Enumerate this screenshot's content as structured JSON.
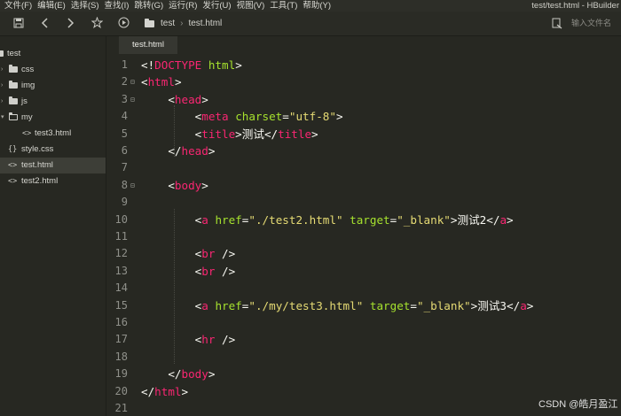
{
  "window": {
    "title": "test/test.html - HBuilder",
    "menu": [
      "文件(F)",
      "编辑(E)",
      "选择(S)",
      "查找(I)",
      "跳转(G)",
      "运行(R)",
      "发行(U)",
      "视图(V)",
      "工具(T)",
      "帮助(Y)"
    ]
  },
  "toolbar": {
    "icons": [
      "save-icon",
      "back-icon",
      "forward-icon",
      "star-icon",
      "run-icon"
    ],
    "breadcrumb": [
      "test",
      "test.html"
    ],
    "search_placeholder": "输入文件名"
  },
  "sidebar": {
    "items": [
      {
        "label": "test",
        "kind": "project",
        "icon": "project-folder-icon"
      },
      {
        "label": "css",
        "kind": "folder",
        "icon": "folder-icon"
      },
      {
        "label": "img",
        "kind": "folder",
        "icon": "folder-icon"
      },
      {
        "label": "js",
        "kind": "folder",
        "icon": "folder-icon"
      },
      {
        "label": "my",
        "kind": "folder-open",
        "icon": "folder-open-icon"
      },
      {
        "label": "test3.html",
        "kind": "html",
        "icon": "html-file-icon"
      },
      {
        "label": "style.css",
        "kind": "css",
        "icon": "css-file-icon"
      },
      {
        "label": "test.html",
        "kind": "html",
        "icon": "html-file-icon",
        "selected": true
      },
      {
        "label": "test2.html",
        "kind": "html",
        "icon": "html-file-icon"
      }
    ]
  },
  "editor": {
    "tab": "test.html",
    "lines": [
      [
        [
          "p",
          "<!"
        ],
        [
          "t",
          "DOCTYPE"
        ],
        [
          "p",
          " "
        ],
        [
          "a",
          "html"
        ],
        [
          "p",
          ">"
        ]
      ],
      [
        [
          "p",
          "<"
        ],
        [
          "t",
          "html"
        ],
        [
          "p",
          ">"
        ]
      ],
      [
        [
          "p",
          "    <"
        ],
        [
          "t",
          "head"
        ],
        [
          "p",
          ">"
        ]
      ],
      [
        [
          "p",
          "        <"
        ],
        [
          "t",
          "meta"
        ],
        [
          "p",
          " "
        ],
        [
          "a",
          "charset"
        ],
        [
          "p",
          "="
        ],
        [
          "s",
          "\"utf-8\""
        ],
        [
          "p",
          ">"
        ]
      ],
      [
        [
          "p",
          "        <"
        ],
        [
          "t",
          "title"
        ],
        [
          "p",
          ">"
        ],
        [
          "x",
          "测试"
        ],
        [
          "p",
          "</"
        ],
        [
          "t",
          "title"
        ],
        [
          "p",
          ">"
        ]
      ],
      [
        [
          "p",
          "    </"
        ],
        [
          "t",
          "head"
        ],
        [
          "p",
          ">"
        ]
      ],
      [],
      [
        [
          "p",
          "    <"
        ],
        [
          "t",
          "body"
        ],
        [
          "p",
          ">"
        ]
      ],
      [],
      [
        [
          "p",
          "        <"
        ],
        [
          "t",
          "a"
        ],
        [
          "p",
          " "
        ],
        [
          "a",
          "href"
        ],
        [
          "p",
          "="
        ],
        [
          "s",
          "\"./test2.html\""
        ],
        [
          "p",
          " "
        ],
        [
          "a",
          "target"
        ],
        [
          "p",
          "="
        ],
        [
          "s",
          "\"_blank\""
        ],
        [
          "p",
          ">"
        ],
        [
          "x",
          "测试2"
        ],
        [
          "p",
          "</"
        ],
        [
          "t",
          "a"
        ],
        [
          "p",
          ">"
        ]
      ],
      [],
      [
        [
          "p",
          "        <"
        ],
        [
          "t",
          "br"
        ],
        [
          "p",
          " />"
        ]
      ],
      [
        [
          "p",
          "        <"
        ],
        [
          "t",
          "br"
        ],
        [
          "p",
          " />"
        ]
      ],
      [],
      [
        [
          "p",
          "        <"
        ],
        [
          "t",
          "a"
        ],
        [
          "p",
          " "
        ],
        [
          "a",
          "href"
        ],
        [
          "p",
          "="
        ],
        [
          "s",
          "\"./my/test3.html\""
        ],
        [
          "p",
          " "
        ],
        [
          "a",
          "target"
        ],
        [
          "p",
          "="
        ],
        [
          "s",
          "\"_blank\""
        ],
        [
          "p",
          ">"
        ],
        [
          "x",
          "测试3"
        ],
        [
          "p",
          "</"
        ],
        [
          "t",
          "a"
        ],
        [
          "p",
          ">"
        ]
      ],
      [],
      [
        [
          "p",
          "        <"
        ],
        [
          "t",
          "hr"
        ],
        [
          "p",
          " />"
        ]
      ],
      [],
      [
        [
          "p",
          "    </"
        ],
        [
          "t",
          "body"
        ],
        [
          "p",
          ">"
        ]
      ],
      [
        [
          "p",
          "</"
        ],
        [
          "t",
          "html"
        ],
        [
          "p",
          ">"
        ]
      ],
      []
    ],
    "fold_markers": {
      "2": "⊟",
      "3": "⊟",
      "8": "⊟"
    }
  },
  "watermark": "CSDN @皓月盈江"
}
